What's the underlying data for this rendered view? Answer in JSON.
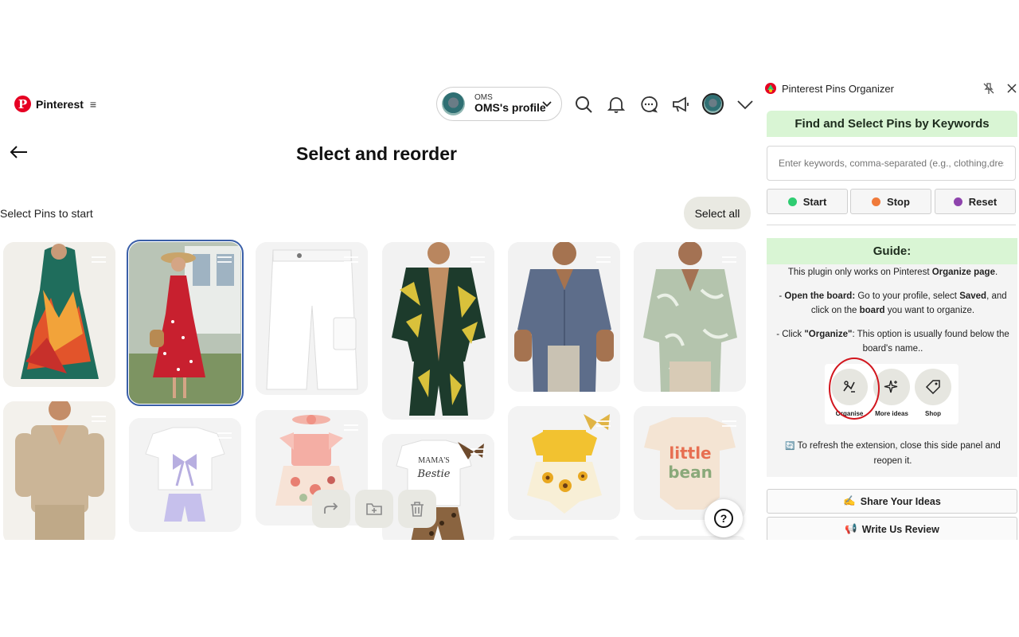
{
  "pinterest": {
    "brand": "Pinterest",
    "menu_glyph": "≡",
    "profile": {
      "small_label": "OMS",
      "name": "OMS's profile"
    },
    "icons": [
      "search-icon",
      "bell-icon",
      "messages-icon",
      "megaphone-icon",
      "avatar",
      "chevron-down-icon"
    ],
    "page_title": "Select and reorder",
    "select_hint": "Select Pins to start",
    "select_all_label": "Select all",
    "help_label": "?",
    "pins": [
      {
        "desc": "tropical print sleeveless dress",
        "selected": false
      },
      {
        "desc": "red floral midi dress",
        "selected": true
      },
      {
        "desc": "white cargo shorts",
        "selected": false
      },
      {
        "desc": "tropical shirt and shorts set",
        "selected": false
      },
      {
        "desc": "blue short sleeve shirt",
        "selected": false
      },
      {
        "desc": "green leaf print shirt",
        "selected": false
      },
      {
        "desc": "beige linen shirt set",
        "selected": false
      },
      {
        "desc": "white bow tee with lavender shorts",
        "selected": false
      },
      {
        "desc": "pink floral baby romper",
        "selected": false
      },
      {
        "desc": "Mama's Bestie baby outfit",
        "selected": false
      },
      {
        "desc": "yellow sunflower baby romper",
        "selected": false
      },
      {
        "desc": "little bean baby onesie",
        "selected": false
      }
    ],
    "pin_texts": {
      "mamas": "MAMA'S",
      "bestie": "Bestie",
      "little": "little",
      "bean": "bean"
    }
  },
  "extension": {
    "title": "Pinterest Pins Organizer",
    "keywords_heading": "Find and Select Pins by Keywords",
    "keywords_placeholder": "Enter keywords, comma-separated (e.g., clothing,dress)",
    "buttons": [
      {
        "label": "Start",
        "color": "#2ecc71"
      },
      {
        "label": "Stop",
        "color": "#f07a3a"
      },
      {
        "label": "Reset",
        "color": "#8e44ad"
      }
    ],
    "guide": {
      "heading": "Guide:",
      "p1_a": "This plugin only works on Pinterest ",
      "p1_b": "Organize page",
      "p1_c": ".",
      "p2_a": "- ",
      "p2_b": "Open the board:",
      "p2_c": " Go to your profile, select ",
      "p2_d": "Saved",
      "p2_e": ", and click on the ",
      "p2_f": "board",
      "p2_g": " you want to organize.",
      "p3_a": "- Click ",
      "p3_b": "\"Organize\"",
      "p3_c": ": This option is usually found below the board's name..",
      "icons": [
        {
          "label": "Organise",
          "icon": "organise-icon"
        },
        {
          "label": "More ideas",
          "icon": "sparkle-icon"
        },
        {
          "label": "Shop",
          "icon": "tag-icon"
        }
      ],
      "refresh_icon": "🔄",
      "refresh_text": " To refresh the extension, close this side panel and reopen it."
    },
    "share_emoji": "✍️",
    "share_label": "Share Your Ideas",
    "review_emoji": "📢",
    "review_label": "Write Us Review"
  }
}
